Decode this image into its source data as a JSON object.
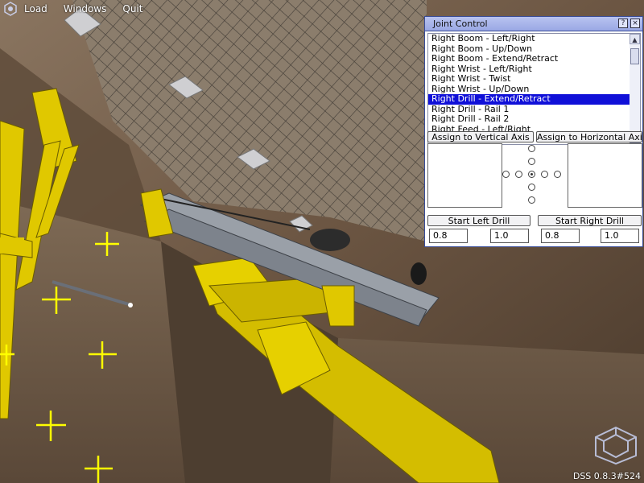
{
  "menu": {
    "items": [
      "Load",
      "Windows",
      "Quit"
    ]
  },
  "joint_control": {
    "title": "Joint Control",
    "list_items": [
      "Right Boom - Left/Right",
      "Right Boom - Up/Down",
      "Right Boom - Extend/Retract",
      "Right Wrist - Left/Right",
      "Right Wrist - Twist",
      "Right Wrist - Up/Down",
      "Right Drill - Extend/Retract",
      "Right Drill - Rail 1",
      "Right Drill - Rail 2",
      "Right Feed - Left/Right"
    ],
    "selected_item": "Right Drill - Extend/Retract",
    "assign_vertical_label": "Assign to Vertical Axis",
    "assign_horizontal_label": "Assign to Horizontal Axis",
    "start_left_drill_label": "Start Left Drill",
    "start_right_drill_label": "Start Right Drill",
    "left_drill_values": [
      "0.8",
      "1.0"
    ],
    "right_drill_values": [
      "0.8",
      "1.0"
    ]
  },
  "status": {
    "version": "DSS 0.8.3#524"
  },
  "colors": {
    "rock": "#6b5542",
    "machine_yellow": "#e0c800",
    "selection_blue": "#1010d8",
    "titlebar": "#a7b2ea"
  }
}
